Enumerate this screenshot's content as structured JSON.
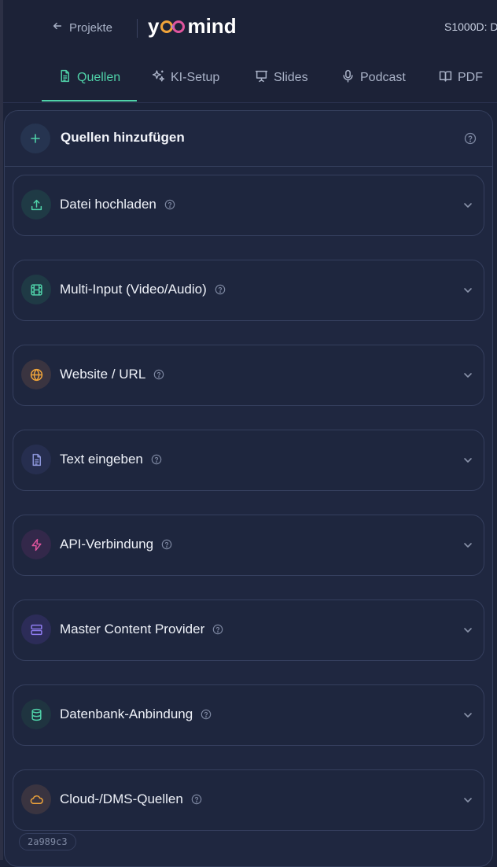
{
  "topbar": {
    "back_label": "Projekte",
    "logo_text_left": "y",
    "logo_text_right": "mind",
    "project_code": "S1000D: D"
  },
  "tabs": [
    {
      "label": "Quellen",
      "icon": "document-icon",
      "active": true
    },
    {
      "label": "KI-Setup",
      "icon": "sparkles-icon",
      "active": false
    },
    {
      "label": "Slides",
      "icon": "presentation-icon",
      "active": false
    },
    {
      "label": "Podcast",
      "icon": "microphone-icon",
      "active": false
    },
    {
      "label": "PDF",
      "icon": "book-icon",
      "active": false
    }
  ],
  "panel": {
    "title": "Quellen hinzufügen",
    "sources": [
      {
        "label": "Datei hochladen",
        "icon": "upload-icon",
        "color": "#4fd1a8"
      },
      {
        "label": "Multi-Input (Video/Audio)",
        "icon": "film-icon",
        "color": "#4fd1a8"
      },
      {
        "label": "Website / URL",
        "icon": "globe-icon",
        "color": "#f0a43a"
      },
      {
        "label": "Text eingeben",
        "icon": "file-text-icon",
        "color": "#8a94d8"
      },
      {
        "label": "API-Verbindung",
        "icon": "bolt-icon",
        "color": "#e0559e"
      },
      {
        "label": "Master Content Provider",
        "icon": "server-icon",
        "color": "#8f7cf0"
      },
      {
        "label": "Datenbank-Anbindung",
        "icon": "database-icon",
        "color": "#4fd1a8"
      },
      {
        "label": "Cloud-/DMS-Quellen",
        "icon": "cloud-icon",
        "color": "#f0a43a"
      }
    ],
    "hash": "2a989c3"
  },
  "colors": {
    "accent": "#4fd1a8",
    "background": "#1b2238",
    "panel": "#1f2740"
  }
}
